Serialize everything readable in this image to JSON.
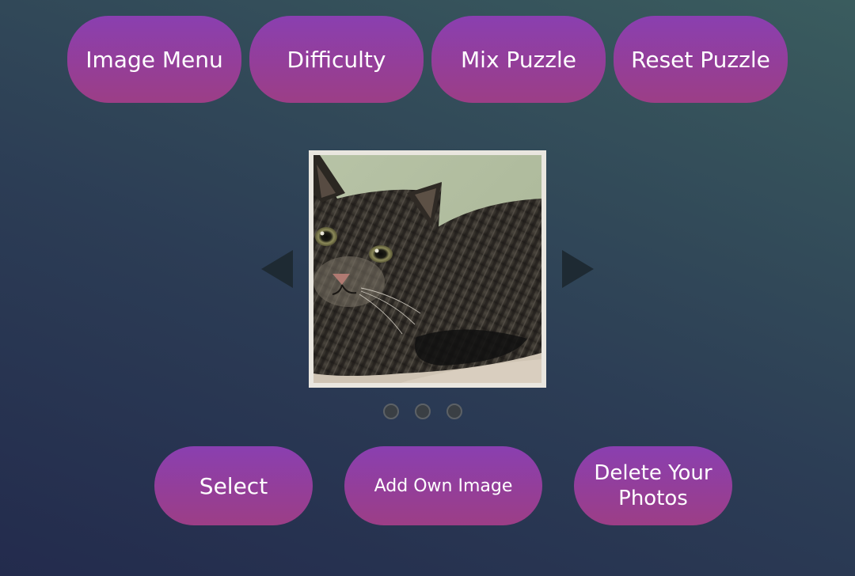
{
  "top_buttons": {
    "image_menu": "Image Menu",
    "difficulty": "Difficulty",
    "mix_puzzle": "Mix Puzzle",
    "reset_puzzle": "Reset Puzzle"
  },
  "carousel": {
    "prev_icon": "triangle-left",
    "next_icon": "triangle-right",
    "image": "tabby cat lying down",
    "dots_count": 3
  },
  "bottom_buttons": {
    "select": "Select",
    "add_own_image": "Add Own Image",
    "delete_photos_line1": "Delete Your",
    "delete_photos_line2": "Photos"
  },
  "colors": {
    "button_top": "#8a3fb0",
    "button_bottom": "#9c3e86",
    "background_dark": "#232b4d",
    "background_light": "#3a5c5e"
  }
}
